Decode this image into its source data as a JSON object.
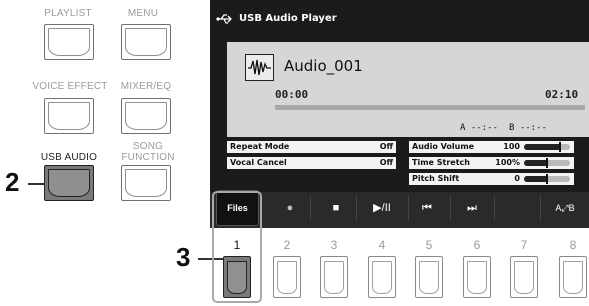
{
  "panel_buttons": [
    {
      "label": "PLAYLIST"
    },
    {
      "label": "MENU"
    },
    {
      "label": "VOICE EFFECT"
    },
    {
      "label": "MIXER/EQ"
    },
    {
      "label": "USB AUDIO"
    },
    {
      "label_line1": "SONG",
      "label_line2": "FUNCTION"
    }
  ],
  "callouts": {
    "step2": "2",
    "step3": "3"
  },
  "screen": {
    "title": "USB Audio Player",
    "title_icon": "usb-icon",
    "file_name": "Audio_001",
    "current_time": "00:00",
    "total_time": "02:10",
    "progress": 0,
    "point_a": "A --:--",
    "point_b": "B --:--",
    "params_left": [
      {
        "label": "Repeat Mode",
        "value": "Off"
      },
      {
        "label": "Vocal Cancel",
        "value": "Off"
      }
    ],
    "params_right": [
      {
        "label": "Audio Volume",
        "value": "100",
        "level": 0.78
      },
      {
        "label": "Time Stretch",
        "value": "100%",
        "level": 0.5
      },
      {
        "label": "Pitch Shift",
        "value": "0",
        "level": 0.5
      }
    ],
    "transport": {
      "files_label": "Files",
      "record_icon": "●",
      "stop_icon": "■",
      "play_pause_icon": "▶/II",
      "rewind_icon": "⏮",
      "fast_forward_icon": "⏭",
      "ab_repeat_label": "A⤢B"
    }
  },
  "number_buttons": [
    "1",
    "2",
    "3",
    "4",
    "5",
    "6",
    "7",
    "8"
  ],
  "colors": {
    "screen_bg": "#1b1b1b",
    "panel_bg": "#d6d6d6"
  }
}
